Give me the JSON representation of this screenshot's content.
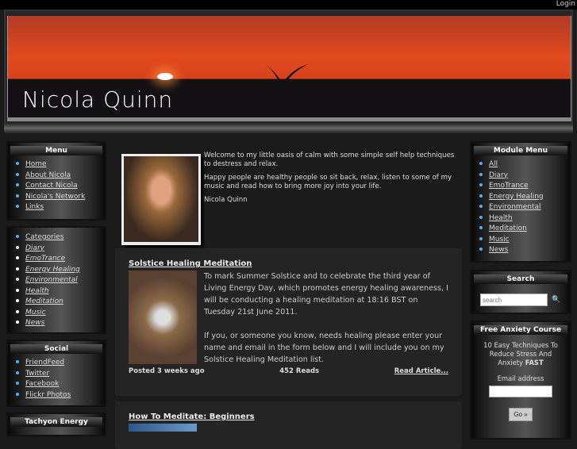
{
  "login": "Login",
  "header": {
    "title": "Nicola Quinn"
  },
  "left": {
    "menu": {
      "title": "Menu",
      "items": [
        "Home",
        "About Nicola",
        "Contact Nicola",
        "Nicola's Network",
        "Links"
      ]
    },
    "categories": {
      "head": "Categories",
      "items": [
        "Diary",
        "EmoTrance",
        "Energy Healing",
        "Environmental",
        "Health",
        "Meditation",
        "Music",
        "News"
      ]
    },
    "social": {
      "title": "Social",
      "items": [
        "FriendFeed",
        "Twitter",
        "Facebook",
        "Flickr Photos"
      ]
    },
    "tachyon": {
      "title": "Tachyon Energy"
    }
  },
  "intro": {
    "p1": "Welcome to my little oasis of calm with some simple self help techniques to destress and relax.",
    "p2": "Happy people are healthy people so sit back, relax, listen to some of my music and read how to bring more joy into your life.",
    "p3": "Nicola Quinn"
  },
  "articles": [
    {
      "title": "Solstice Healing Meditation",
      "p1": "To mark Summer Solstice and to celebrate the third year of Living Energy Day, which promotes energy healing awareness, I will be conducting a healing meditation at 18:16 BST on Tuesday 21st June 2011.",
      "p2": "If you, or someone you know, needs healing please enter your name and email in the form below and I will include you on my Solstice Healing Meditation list.",
      "posted": "Posted 3 weeks ago",
      "reads": "452 Reads",
      "more": "Read Article..."
    },
    {
      "title": "How To Meditate: Beginners"
    }
  ],
  "right": {
    "module": {
      "title": "Module Menu",
      "items": [
        "All",
        "Diary",
        "EmoTrance",
        "Energy Healing",
        "Environmental",
        "Health",
        "Meditation",
        "Music",
        "News"
      ]
    },
    "search": {
      "title": "Search",
      "placeholder": "search"
    },
    "anxiety": {
      "title": "Free Anxiety Course",
      "line1": "10 Easy Techniques To Reduce Stress And Anxiety ",
      "bold": "FAST",
      "email_label": "Email address",
      "go": "Go »"
    }
  }
}
